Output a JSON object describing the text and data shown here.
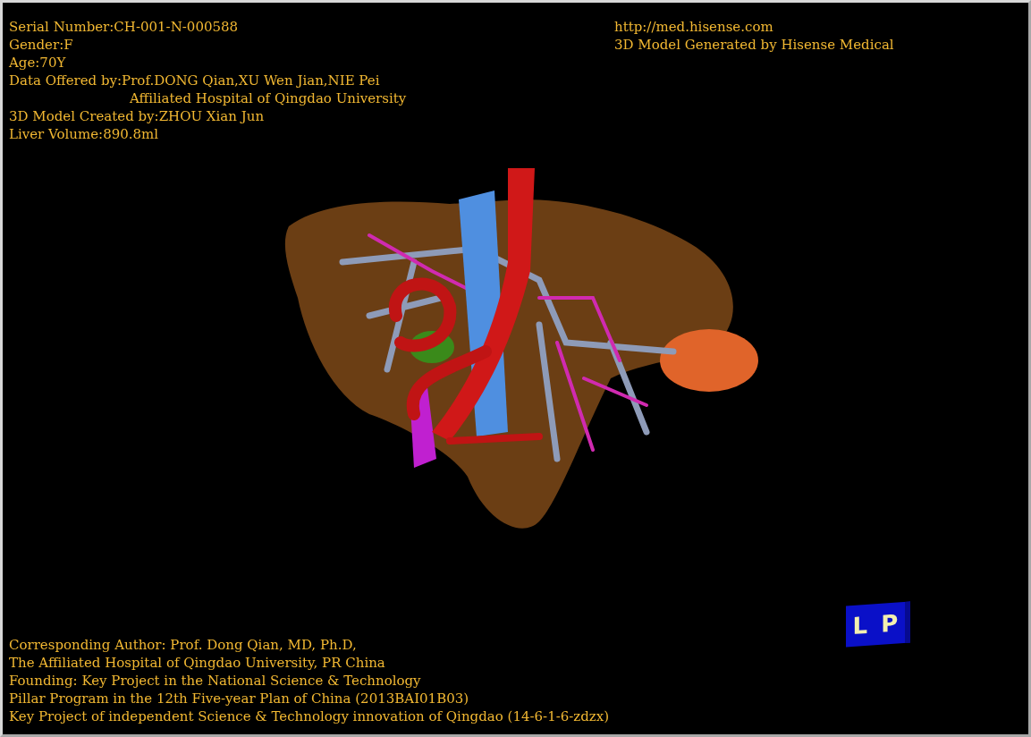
{
  "patient_info": [
    {
      "text": "Serial Number:CH-001-N-000588",
      "kind": "line"
    },
    {
      "text": "Gender:F",
      "kind": "line"
    },
    {
      "text": "Age:70Y",
      "kind": "line"
    },
    {
      "text": "Data Offered by:Prof.DONG Qian,XU Wen Jian,NIE Pei",
      "kind": "line"
    },
    {
      "text": "Affiliated Hospital of Qingdao University",
      "kind": "continuation"
    },
    {
      "text": "3D Model Created by:ZHOU Xian Jun",
      "kind": "line"
    },
    {
      "text": "Liver Volume:890.8ml",
      "kind": "line"
    }
  ],
  "generator_info": [
    "http://med.hisense.com",
    "3D Model Generated by Hisense Medical"
  ],
  "orientation_cube": {
    "labels": [
      "L",
      "P"
    ]
  },
  "credits": [
    "Corresponding Author: Prof. Dong Qian, MD, Ph.D,",
    "The Affiliated Hospital of Qingdao University, PR China",
    "Founding: Key Project in the National Science & Technology",
    "Pillar Program in the 12th Five-year Plan of China (2013BAI01B03)",
    "Key Project of independent Science & Technology innovation of Qingdao (14-6-1-6-zdzx)"
  ]
}
